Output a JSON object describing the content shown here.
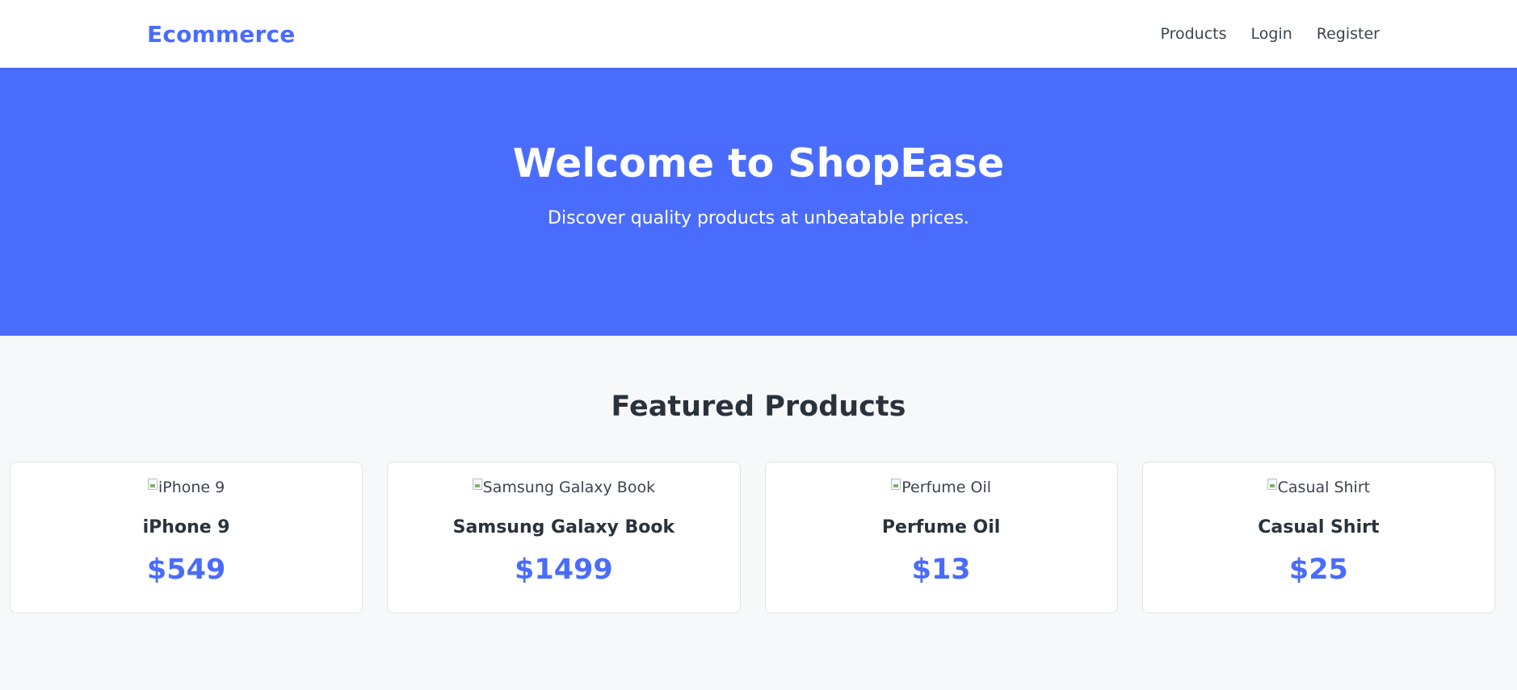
{
  "navbar": {
    "brand": "Ecommerce",
    "links": [
      {
        "label": "Products"
      },
      {
        "label": "Login"
      },
      {
        "label": "Register"
      }
    ]
  },
  "hero": {
    "title": "Welcome to ShopEase",
    "subtitle": "Discover quality products at unbeatable prices."
  },
  "featured": {
    "title": "Featured Products",
    "products": [
      {
        "image_alt": "iPhone 9",
        "name": "iPhone 9",
        "price": "$549"
      },
      {
        "image_alt": "Samsung Galaxy Book",
        "name": "Samsung Galaxy Book",
        "price": "$1499"
      },
      {
        "image_alt": "Perfume Oil",
        "name": "Perfume Oil",
        "price": "$13"
      },
      {
        "image_alt": "Casual Shirt",
        "name": "Casual Shirt",
        "price": "$25"
      }
    ]
  },
  "colors": {
    "brand_blue": "#4a6cfd",
    "text_dark": "#2a323c",
    "page_bg": "#f7f8fa"
  }
}
